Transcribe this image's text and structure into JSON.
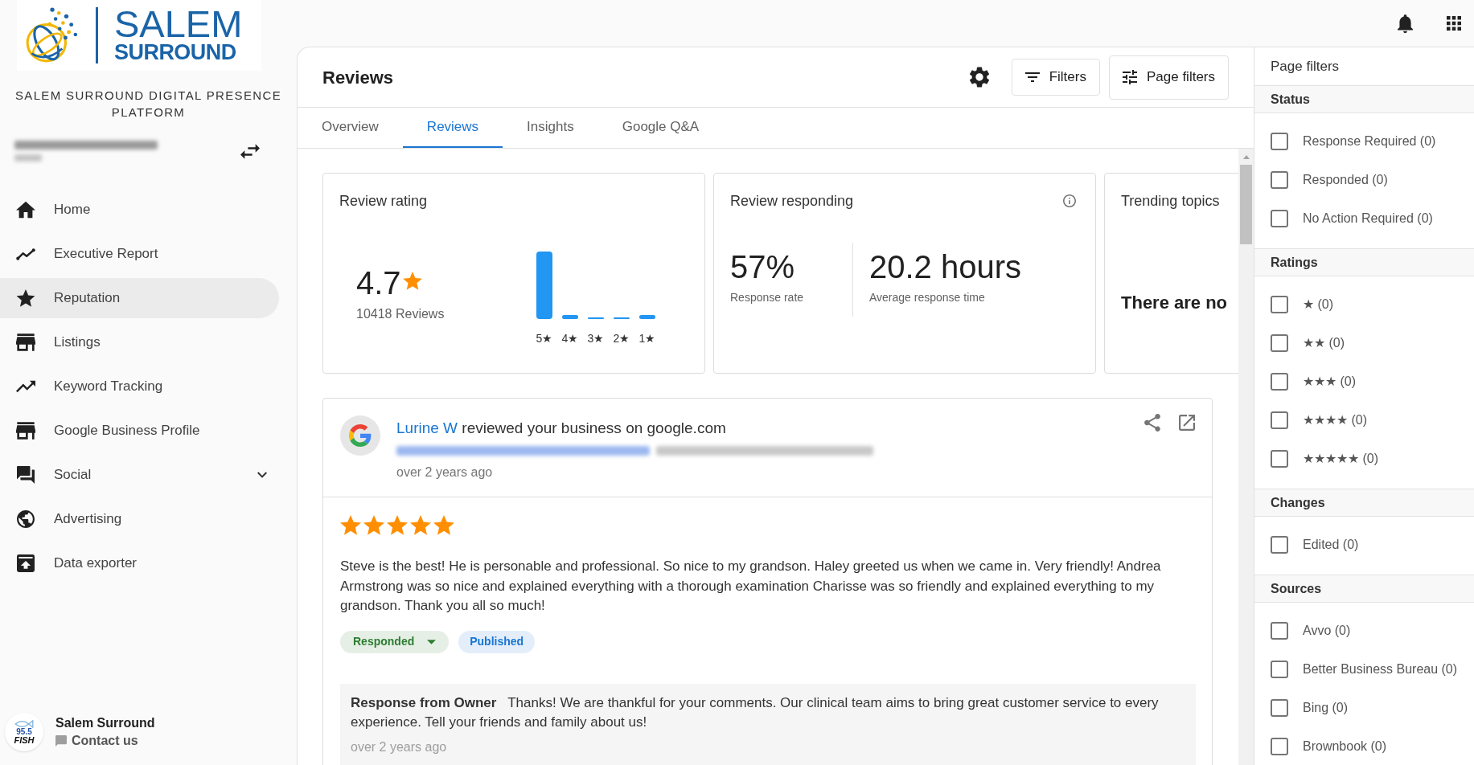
{
  "sidebar": {
    "logo": {
      "title": "SALEM",
      "subtitle": "SURROUND"
    },
    "tagline": "SALEM SURROUND DIGITAL PRESENCE PLATFORM",
    "nav_items": [
      {
        "label": "Home",
        "kind": "link",
        "selected": false
      },
      {
        "label": "Executive Report",
        "kind": "link",
        "selected": false
      },
      {
        "label": "Reputation",
        "kind": "link",
        "selected": true
      },
      {
        "label": "Listings",
        "kind": "link",
        "selected": false
      },
      {
        "label": "Keyword Tracking",
        "kind": "link",
        "selected": false
      },
      {
        "label": "Google Business Profile",
        "kind": "link",
        "selected": false
      },
      {
        "label": "Social",
        "kind": "group",
        "selected": false
      },
      {
        "label": "Advertising",
        "kind": "link",
        "selected": false
      },
      {
        "label": "Data exporter",
        "kind": "link",
        "selected": false
      }
    ],
    "footer": {
      "avatar_lines": [
        "95.5",
        "FISH"
      ],
      "name": "Salem Surround",
      "contact_link": "Contact us"
    }
  },
  "main": {
    "title": "Reviews",
    "buttons": [
      {
        "label": "Filters"
      },
      {
        "label": "Page filters"
      }
    ],
    "tabs": [
      {
        "label": "Overview",
        "selected": false
      },
      {
        "label": "Reviews",
        "selected": true
      },
      {
        "label": "Insights",
        "selected": false
      },
      {
        "label": "Google Q&A",
        "selected": false
      }
    ],
    "summary_cards": [
      {
        "kind": "rating",
        "title": "Review rating",
        "rating": "4.7",
        "count": "10418 Reviews",
        "bar_labels": [
          "5★",
          "4★",
          "3★",
          "2★",
          "1★"
        ]
      },
      {
        "kind": "responding",
        "title": "Review responding",
        "metrics": [
          {
            "value": "57%",
            "label": "Response rate"
          },
          {
            "value": "20.2 hours",
            "label": "Average response time"
          }
        ]
      },
      {
        "kind": "topics",
        "title": "Trending topics",
        "message": "There are no"
      }
    ],
    "review": {
      "reviewer": "Lurine W",
      "headline": "reviewed your business on google.com",
      "time": "over 2 years ago",
      "stars": 5,
      "text": "Steve is the best! He is personable and professional. So nice to my grandson. Haley greeted us when we came in. Very friendly! Andrea Armstrong was so nice and explained everything with a thorough examination Charisse was so friendly and explained everything to my grandson. Thank you all so much!",
      "badges": [
        {
          "label": "Responded",
          "kind": "dropdown",
          "color": "#2e7d32"
        },
        {
          "label": "Published",
          "kind": "plain",
          "color": "#1976d2"
        }
      ],
      "response": {
        "text": "**Response from Owner**   Thanks! We are thankful for your comments. Our clinical team aims to bring great customer service to every experience. Tell your friends and family about us!",
        "time": "over 2 years ago"
      }
    }
  },
  "filter_panel": {
    "title": "Page filters",
    "sections": [
      {
        "heading": "Status",
        "options": [
          {
            "label": "Response Required (0)",
            "checked": false
          },
          {
            "label": "Responded (0)",
            "checked": false
          },
          {
            "label": "No Action Required (0)",
            "checked": false
          }
        ]
      },
      {
        "heading": "Ratings",
        "options": [
          {
            "label": "★ (0)",
            "checked": false
          },
          {
            "label": "★★ (0)",
            "checked": false
          },
          {
            "label": "★★★ (0)",
            "checked": false
          },
          {
            "label": "★★★★ (0)",
            "checked": false
          },
          {
            "label": "★★★★★ (0)",
            "checked": false
          }
        ]
      },
      {
        "heading": "Changes",
        "options": [
          {
            "label": "Edited (0)",
            "checked": false
          }
        ]
      },
      {
        "heading": "Sources",
        "options": [
          {
            "label": "Avvo (0)",
            "checked": false
          },
          {
            "label": "Better Business Bureau (0)",
            "checked": false
          },
          {
            "label": "Bing (0)",
            "checked": false
          },
          {
            "label": "Brownbook (0)",
            "checked": false
          }
        ]
      }
    ]
  }
}
